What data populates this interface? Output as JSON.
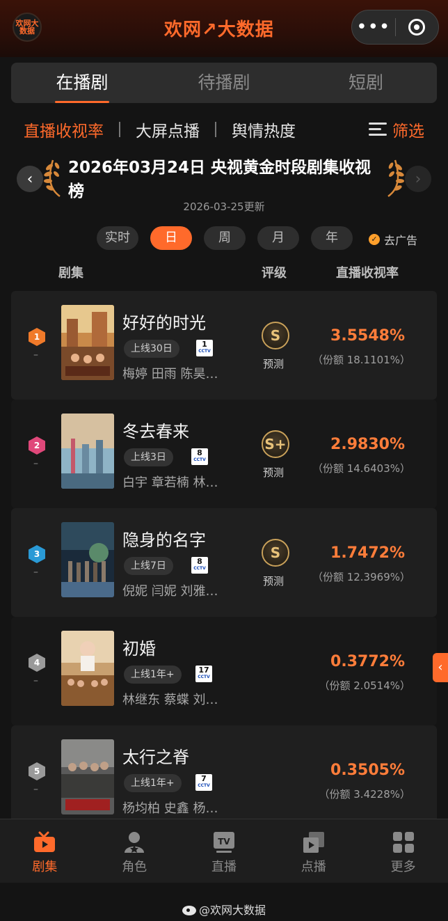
{
  "header": {
    "logo_text": "欢网大数据",
    "brand": "欢网↗大数据"
  },
  "main_tabs": [
    {
      "label": "在播剧",
      "active": true
    },
    {
      "label": "待播剧",
      "active": false
    },
    {
      "label": "短剧",
      "active": false
    }
  ],
  "sub_tabs": [
    {
      "label": "直播收视率",
      "active": true
    },
    {
      "label": "大屏点播",
      "active": false
    },
    {
      "label": "舆情热度",
      "active": false
    }
  ],
  "filter_label": "筛选",
  "chart_title": "2026年03月24日 央视黄金时段剧集收视榜",
  "updated": "2026-03-25更新",
  "periods": [
    {
      "label": "实时",
      "active": false
    },
    {
      "label": "日",
      "active": true
    },
    {
      "label": "周",
      "active": false
    },
    {
      "label": "月",
      "active": false
    },
    {
      "label": "年",
      "active": false
    }
  ],
  "remove_ads": "去广告",
  "columns": {
    "drama": "剧集",
    "rating": "评级",
    "share": "直播收视率"
  },
  "rows": [
    {
      "rank": "1",
      "change": "–",
      "title": "好好的时光",
      "days": "上线30日",
      "channel": "1",
      "cast": "梅婷 田雨 陈昊…",
      "grade": "S",
      "grade_label": "预测",
      "rating": "3.5548%",
      "share": "（份额 18.1101%）"
    },
    {
      "rank": "2",
      "change": "–",
      "title": "冬去春来",
      "days": "上线3日",
      "channel": "8",
      "cast": "白宇 章若楠 林…",
      "grade": "S+",
      "grade_label": "预测",
      "rating": "2.9830%",
      "share": "（份额 14.6403%）"
    },
    {
      "rank": "3",
      "change": "–",
      "title": "隐身的名字",
      "days": "上线7日",
      "channel": "8",
      "cast": "倪妮 闫妮 刘雅…",
      "grade": "S",
      "grade_label": "预测",
      "rating": "1.7472%",
      "share": "（份额 12.3969%）"
    },
    {
      "rank": "4",
      "change": "–",
      "title": "初婚",
      "days": "上线1年+",
      "channel": "17",
      "cast": "林继东 蔡蝶 刘…",
      "grade": "",
      "grade_label": "",
      "rating": "0.3772%",
      "share": "（份额 2.0514%）"
    },
    {
      "rank": "5",
      "change": "–",
      "title": "太行之脊",
      "days": "上线1年+",
      "channel": "7",
      "cast": "杨均柏 史鑫 杨…",
      "grade": "",
      "grade_label": "",
      "rating": "0.3505%",
      "share": "（份额 3.4228%）"
    }
  ],
  "cctv_label": "CCTV",
  "bottom_nav": [
    {
      "label": "剧集",
      "icon": "tv-play-icon",
      "active": true
    },
    {
      "label": "角色",
      "icon": "person-icon",
      "active": false
    },
    {
      "label": "直播",
      "icon": "tv-live-icon",
      "active": false
    },
    {
      "label": "点播",
      "icon": "vod-icon",
      "active": false
    },
    {
      "label": "更多",
      "icon": "grid-icon",
      "active": false
    }
  ],
  "watermark": "@欢网大数据",
  "colors": {
    "accent": "#ff6a2b",
    "background": "#141414",
    "rating": "#ff7d3a"
  }
}
